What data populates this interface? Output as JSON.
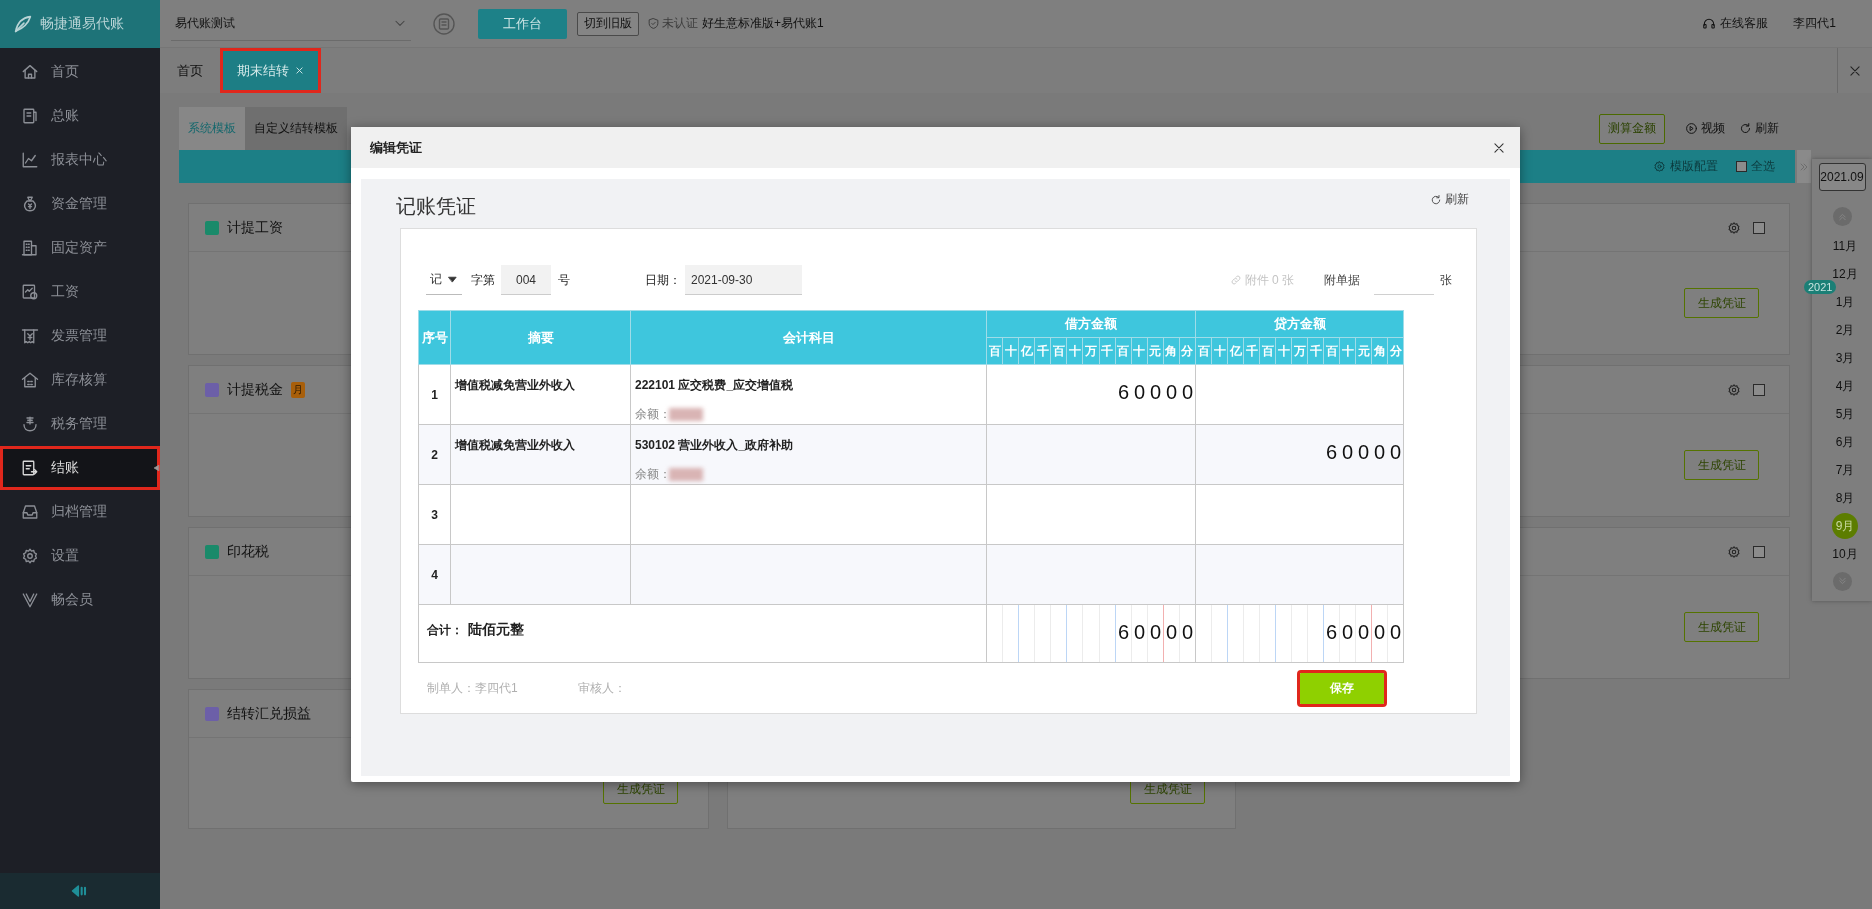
{
  "sidebar": {
    "logo": "畅捷通易代账",
    "items": [
      {
        "label": "首页",
        "selected": false,
        "highlighted": false
      },
      {
        "label": "总账",
        "selected": false,
        "highlighted": false
      },
      {
        "label": "报表中心",
        "selected": false,
        "highlighted": false
      },
      {
        "label": "资金管理",
        "selected": false,
        "highlighted": false
      },
      {
        "label": "固定资产",
        "selected": false,
        "highlighted": false
      },
      {
        "label": "工资",
        "selected": false,
        "highlighted": false
      },
      {
        "label": "发票管理",
        "selected": false,
        "highlighted": false
      },
      {
        "label": "库存核算",
        "selected": false,
        "highlighted": false
      },
      {
        "label": "税务管理",
        "selected": false,
        "highlighted": false
      },
      {
        "label": "结账",
        "selected": true,
        "highlighted": true
      },
      {
        "label": "归档管理",
        "selected": false,
        "highlighted": false
      },
      {
        "label": "设置",
        "selected": false,
        "highlighted": false
      },
      {
        "label": "畅会员",
        "selected": false,
        "highlighted": false
      }
    ]
  },
  "header": {
    "company": "易代账测试",
    "workbench": "工作台",
    "old_version": "切到旧版",
    "certification": "未认证",
    "edition": "好生意标准版+易代账1",
    "support": "在线客服",
    "user": "李四代1"
  },
  "tabs": [
    {
      "label": "首页",
      "selected": false,
      "closable": false,
      "highlighted": false
    },
    {
      "label": "期末结转",
      "selected": true,
      "closable": true,
      "highlighted": true
    }
  ],
  "closing": {
    "subtabs": [
      {
        "label": "系统模板",
        "selected": true
      },
      {
        "label": "自定义结转模板",
        "selected": false
      }
    ],
    "estimate_button": "测算金额",
    "video": "视频",
    "refresh": "刷新",
    "template_config": "模版配置",
    "select_all": {
      "label": "全选",
      "checked": false
    },
    "columns": [
      [
        {
          "title": "计提工资"
        },
        {
          "title": "计提税金",
          "badge": "月"
        },
        {
          "title": "印花税"
        },
        {
          "title": "结转汇兑损益",
          "button": "生成凭证"
        }
      ],
      [
        {},
        {},
        {},
        {
          "button": "生成凭证"
        }
      ],
      [
        {
          "checked": false,
          "button": "生成凭证"
        },
        {
          "checked": false,
          "button": "生成凭证"
        },
        {
          "checked": false,
          "button": "生成凭证"
        }
      ]
    ]
  },
  "calendar": {
    "period": "2021.09",
    "months": [
      {
        "label": "11月",
        "selected": false
      },
      {
        "label": "12月",
        "selected": false
      },
      {
        "label": "1月",
        "selected": false,
        "year": "2021"
      },
      {
        "label": "2月",
        "selected": false
      },
      {
        "label": "3月",
        "selected": false
      },
      {
        "label": "4月",
        "selected": false
      },
      {
        "label": "5月",
        "selected": false
      },
      {
        "label": "6月",
        "selected": false
      },
      {
        "label": "7月",
        "selected": false
      },
      {
        "label": "8月",
        "selected": false
      },
      {
        "label": "9月",
        "selected": true
      },
      {
        "label": "10月",
        "selected": false
      }
    ]
  },
  "dialog": {
    "title": "编辑凭证",
    "heading": "记账凭证",
    "refresh": "刷新",
    "voucher_type": "记",
    "number_prefix": "字第",
    "number": "004",
    "number_suffix": "号",
    "date_label": "日期：",
    "date": "2021-09-30",
    "attachment": {
      "label": "附件 0 张",
      "disabled": true
    },
    "receipt_label": "附单据",
    "receipt_unit": "张",
    "table": {
      "columns": [
        "序号",
        "摘要",
        "会计科目"
      ],
      "debit": {
        "title": "借方金额",
        "units": [
          "百",
          "十",
          "亿",
          "千",
          "百",
          "十",
          "万",
          "千",
          "百",
          "十",
          "元",
          "角",
          "分"
        ]
      },
      "credit": {
        "title": "贷方金额",
        "units": [
          "百",
          "十",
          "亿",
          "千",
          "百",
          "十",
          "万",
          "千",
          "百",
          "十",
          "元",
          "角",
          "分"
        ]
      },
      "rows": [
        {
          "number": "1",
          "summary": "增值税减免营业外收入",
          "account": "222101 应交税费_应交增值税",
          "balance_label": "余额：",
          "debit": "60000"
        },
        {
          "number": "2",
          "summary": "增值税减免营业外收入",
          "account": "530102 营业外收入_政府补助",
          "balance_label": "余额：",
          "credit": "60000"
        },
        {
          "number": "3"
        },
        {
          "number": "4"
        }
      ],
      "total": {
        "label": "合计：",
        "words": "陆佰元整",
        "debit": "60000",
        "credit": "60000"
      }
    },
    "maker": "制单人：李四代1",
    "reviewer": "审核人：",
    "save": {
      "label": "保存",
      "highlighted": true
    }
  }
}
